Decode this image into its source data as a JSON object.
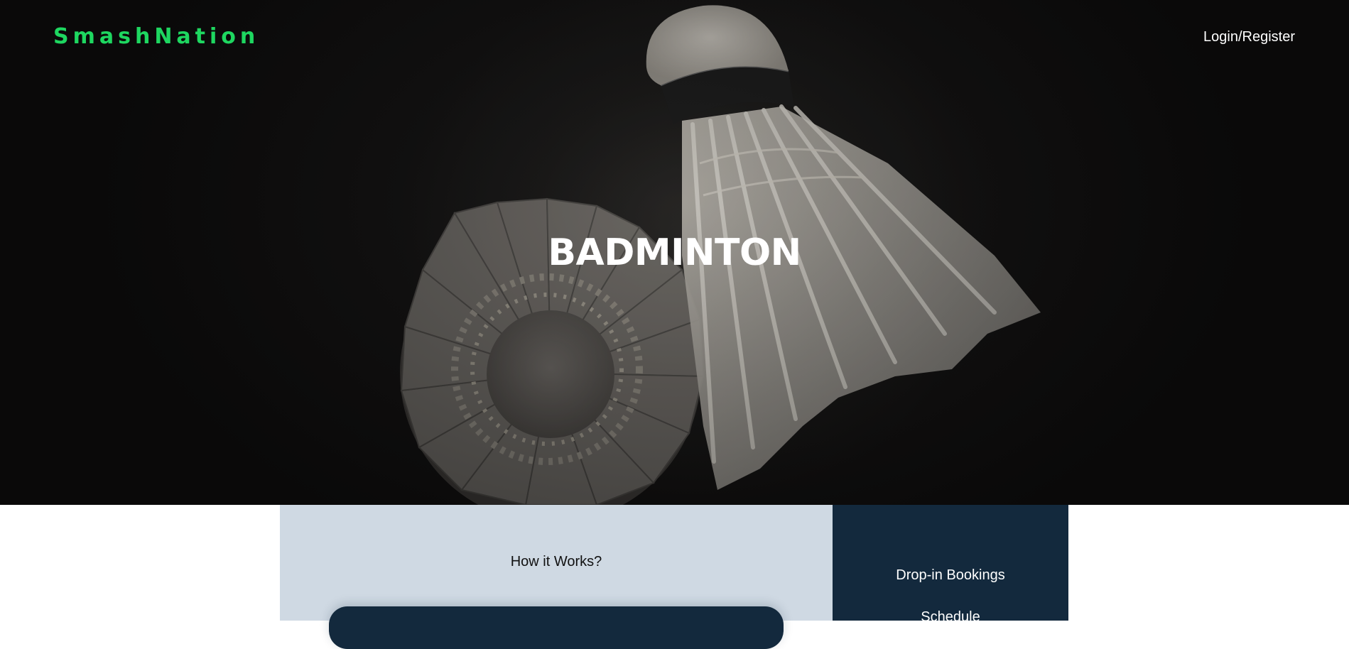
{
  "header": {
    "brand": "SmashNation",
    "login_label": "Login/Register"
  },
  "hero": {
    "title": "BADMINTON"
  },
  "how_it_works": {
    "title": "How it Works?"
  },
  "sidebar": {
    "links": [
      {
        "label": "Drop-in Bookings"
      },
      {
        "label": "Schedule"
      }
    ]
  },
  "colors": {
    "brand": "#1ed760",
    "navy": "#13293d",
    "panel_light": "#cfd9e3"
  }
}
